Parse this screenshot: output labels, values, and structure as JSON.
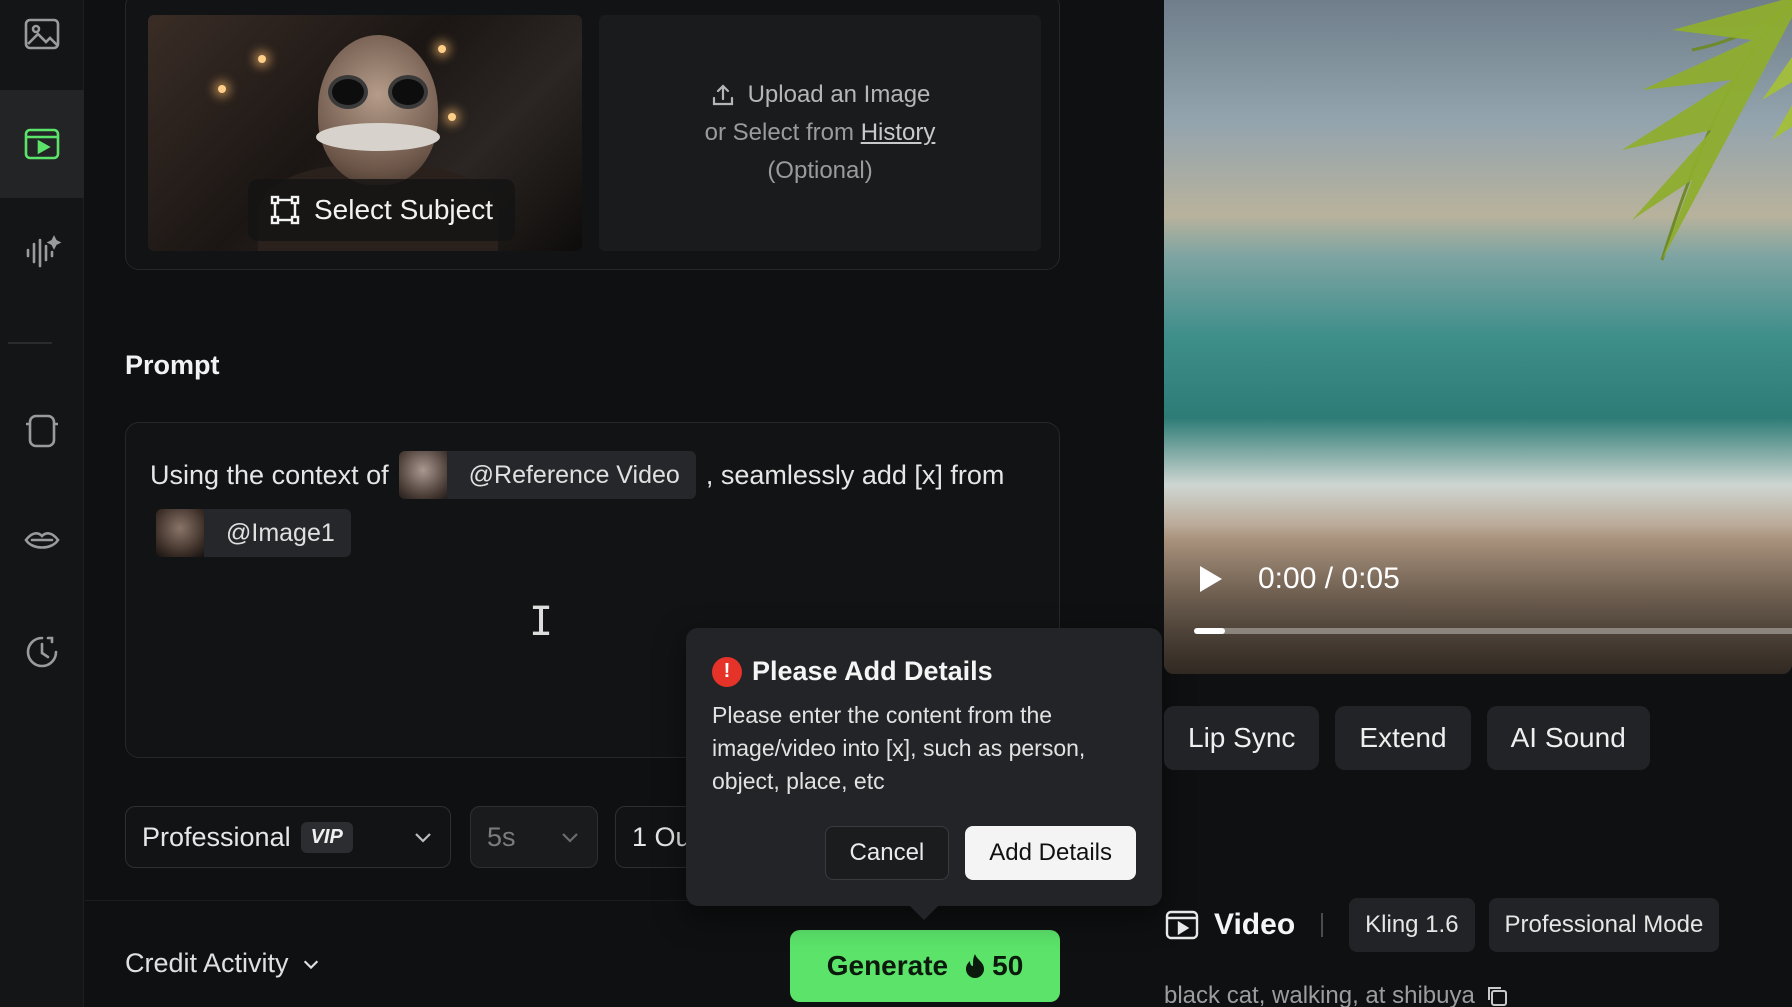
{
  "sidebar": {
    "icons": [
      "image-icon",
      "video-icon",
      "audio-icon",
      "effects-icon",
      "lip-icon",
      "history-icon"
    ]
  },
  "upload": {
    "select_subject_label": "Select Subject",
    "upload_line": "Upload an Image",
    "or_select": "or Select from",
    "history_link": "History",
    "optional": "(Optional)"
  },
  "prompt": {
    "label": "Prompt",
    "text_before": "Using the context of",
    "reference_chip": "@Reference Video",
    "text_after": ", seamlessly add [x] from",
    "image_chip": "@Image1"
  },
  "options": {
    "mode": "Professional",
    "vip_badge": "VIP",
    "duration": "5s",
    "outputs": "1 Ou"
  },
  "footer": {
    "credit_label": "Credit Activity",
    "generate_label": "Generate",
    "generate_cost": "50"
  },
  "dialog": {
    "title": "Please Add Details",
    "body": "Please enter the content from the image/video into [x], such as person, object, place, etc",
    "cancel": "Cancel",
    "confirm": "Add Details"
  },
  "preview": {
    "time": "0:00 / 0:05",
    "progress": 0.05
  },
  "actions": {
    "lip_sync": "Lip Sync",
    "extend": "Extend",
    "ai_sound": "AI Sound"
  },
  "video_info": {
    "title": "Video",
    "model": "Kling 1.6",
    "mode": "Professional Mode",
    "caption": "black cat, walking, at shibuya"
  },
  "colors": {
    "accent_green": "#5be36a",
    "alert_red": "#e5332a"
  }
}
